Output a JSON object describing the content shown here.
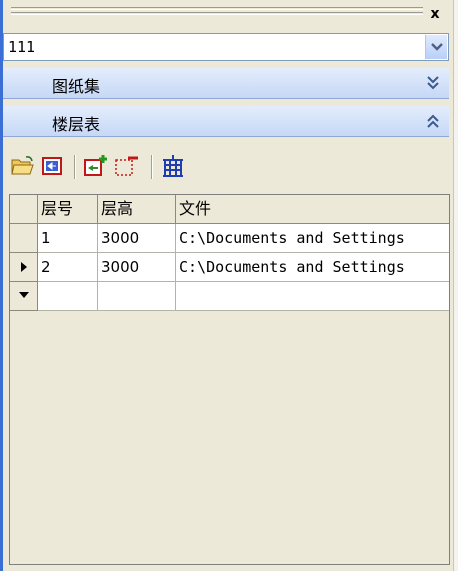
{
  "window": {
    "close_label": "x"
  },
  "layer_combo": {
    "value": "111"
  },
  "sections": [
    {
      "label": "图纸集",
      "state": "collapsed",
      "icon": "chevron-double-down-icon"
    },
    {
      "label": "楼层表",
      "state": "expanded",
      "icon": "chevron-double-up-icon"
    }
  ],
  "toolbar": {
    "buttons": [
      {
        "icon": "open-folder-icon"
      },
      {
        "icon": "import-floor-icon"
      },
      {
        "icon": "add-floor-icon"
      },
      {
        "icon": "delete-floor-icon"
      },
      {
        "icon": "building-icon"
      }
    ]
  },
  "grid": {
    "columns": [
      "层号",
      "层高",
      "文件"
    ],
    "rows": [
      {
        "floor": "1",
        "height": "3000",
        "file": "C:\\Documents and Settings",
        "indicator": ""
      },
      {
        "floor": "2",
        "height": "3000",
        "file": "C:\\Documents and Settings",
        "indicator": "current-row-arrow-icon"
      },
      {
        "floor": "",
        "height": "",
        "file": "",
        "indicator": "new-row-dropdown-icon"
      }
    ]
  },
  "colors": {
    "accent_blue": "#3b6fd6",
    "section_bg": "#c6d8f6",
    "toolbar_bg": "#ece9d8"
  }
}
